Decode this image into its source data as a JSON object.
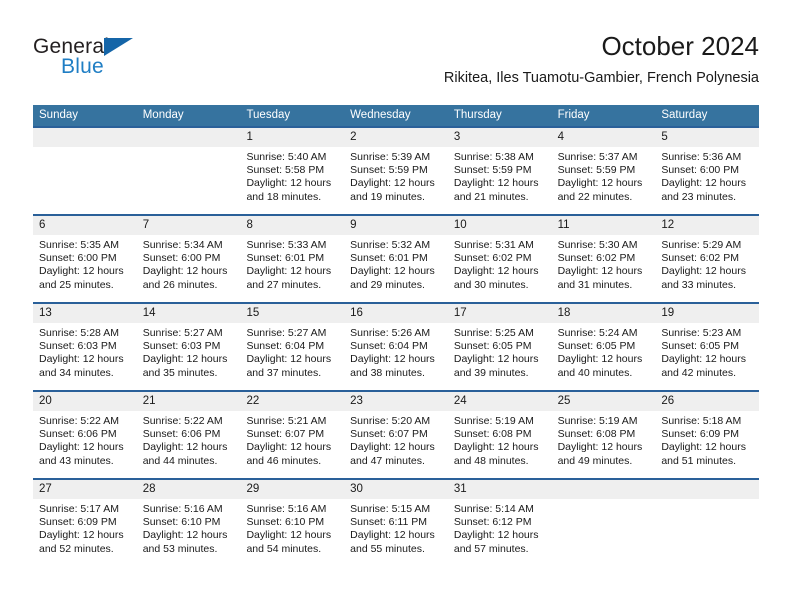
{
  "brand": {
    "name_part1": "General",
    "name_part2": "Blue",
    "logo_icon": "triangle-flag-icon",
    "accent_color": "#1565a8",
    "text_color": "#1f7ec4"
  },
  "header": {
    "title": "October 2024",
    "subtitle": "Rikitea, Iles Tuamotu-Gambier, French Polynesia"
  },
  "calendar": {
    "header_background": "#36739f",
    "row_divider_color": "#2a6099",
    "day_band_background": "#efefef",
    "weekdays": [
      "Sunday",
      "Monday",
      "Tuesday",
      "Wednesday",
      "Thursday",
      "Friday",
      "Saturday"
    ],
    "weeks": [
      [
        {
          "day": "",
          "empty": true,
          "sunrise": "",
          "sunset": "",
          "daylight_line1": "",
          "daylight_line2": ""
        },
        {
          "day": "",
          "empty": true,
          "sunrise": "",
          "sunset": "",
          "daylight_line1": "",
          "daylight_line2": ""
        },
        {
          "day": "1",
          "sunrise": "Sunrise: 5:40 AM",
          "sunset": "Sunset: 5:58 PM",
          "daylight_line1": "Daylight: 12 hours",
          "daylight_line2": "and 18 minutes."
        },
        {
          "day": "2",
          "sunrise": "Sunrise: 5:39 AM",
          "sunset": "Sunset: 5:59 PM",
          "daylight_line1": "Daylight: 12 hours",
          "daylight_line2": "and 19 minutes."
        },
        {
          "day": "3",
          "sunrise": "Sunrise: 5:38 AM",
          "sunset": "Sunset: 5:59 PM",
          "daylight_line1": "Daylight: 12 hours",
          "daylight_line2": "and 21 minutes."
        },
        {
          "day": "4",
          "sunrise": "Sunrise: 5:37 AM",
          "sunset": "Sunset: 5:59 PM",
          "daylight_line1": "Daylight: 12 hours",
          "daylight_line2": "and 22 minutes."
        },
        {
          "day": "5",
          "sunrise": "Sunrise: 5:36 AM",
          "sunset": "Sunset: 6:00 PM",
          "daylight_line1": "Daylight: 12 hours",
          "daylight_line2": "and 23 minutes."
        }
      ],
      [
        {
          "day": "6",
          "sunrise": "Sunrise: 5:35 AM",
          "sunset": "Sunset: 6:00 PM",
          "daylight_line1": "Daylight: 12 hours",
          "daylight_line2": "and 25 minutes."
        },
        {
          "day": "7",
          "sunrise": "Sunrise: 5:34 AM",
          "sunset": "Sunset: 6:00 PM",
          "daylight_line1": "Daylight: 12 hours",
          "daylight_line2": "and 26 minutes."
        },
        {
          "day": "8",
          "sunrise": "Sunrise: 5:33 AM",
          "sunset": "Sunset: 6:01 PM",
          "daylight_line1": "Daylight: 12 hours",
          "daylight_line2": "and 27 minutes."
        },
        {
          "day": "9",
          "sunrise": "Sunrise: 5:32 AM",
          "sunset": "Sunset: 6:01 PM",
          "daylight_line1": "Daylight: 12 hours",
          "daylight_line2": "and 29 minutes."
        },
        {
          "day": "10",
          "sunrise": "Sunrise: 5:31 AM",
          "sunset": "Sunset: 6:02 PM",
          "daylight_line1": "Daylight: 12 hours",
          "daylight_line2": "and 30 minutes."
        },
        {
          "day": "11",
          "sunrise": "Sunrise: 5:30 AM",
          "sunset": "Sunset: 6:02 PM",
          "daylight_line1": "Daylight: 12 hours",
          "daylight_line2": "and 31 minutes."
        },
        {
          "day": "12",
          "sunrise": "Sunrise: 5:29 AM",
          "sunset": "Sunset: 6:02 PM",
          "daylight_line1": "Daylight: 12 hours",
          "daylight_line2": "and 33 minutes."
        }
      ],
      [
        {
          "day": "13",
          "sunrise": "Sunrise: 5:28 AM",
          "sunset": "Sunset: 6:03 PM",
          "daylight_line1": "Daylight: 12 hours",
          "daylight_line2": "and 34 minutes."
        },
        {
          "day": "14",
          "sunrise": "Sunrise: 5:27 AM",
          "sunset": "Sunset: 6:03 PM",
          "daylight_line1": "Daylight: 12 hours",
          "daylight_line2": "and 35 minutes."
        },
        {
          "day": "15",
          "sunrise": "Sunrise: 5:27 AM",
          "sunset": "Sunset: 6:04 PM",
          "daylight_line1": "Daylight: 12 hours",
          "daylight_line2": "and 37 minutes."
        },
        {
          "day": "16",
          "sunrise": "Sunrise: 5:26 AM",
          "sunset": "Sunset: 6:04 PM",
          "daylight_line1": "Daylight: 12 hours",
          "daylight_line2": "and 38 minutes."
        },
        {
          "day": "17",
          "sunrise": "Sunrise: 5:25 AM",
          "sunset": "Sunset: 6:05 PM",
          "daylight_line1": "Daylight: 12 hours",
          "daylight_line2": "and 39 minutes."
        },
        {
          "day": "18",
          "sunrise": "Sunrise: 5:24 AM",
          "sunset": "Sunset: 6:05 PM",
          "daylight_line1": "Daylight: 12 hours",
          "daylight_line2": "and 40 minutes."
        },
        {
          "day": "19",
          "sunrise": "Sunrise: 5:23 AM",
          "sunset": "Sunset: 6:05 PM",
          "daylight_line1": "Daylight: 12 hours",
          "daylight_line2": "and 42 minutes."
        }
      ],
      [
        {
          "day": "20",
          "sunrise": "Sunrise: 5:22 AM",
          "sunset": "Sunset: 6:06 PM",
          "daylight_line1": "Daylight: 12 hours",
          "daylight_line2": "and 43 minutes."
        },
        {
          "day": "21",
          "sunrise": "Sunrise: 5:22 AM",
          "sunset": "Sunset: 6:06 PM",
          "daylight_line1": "Daylight: 12 hours",
          "daylight_line2": "and 44 minutes."
        },
        {
          "day": "22",
          "sunrise": "Sunrise: 5:21 AM",
          "sunset": "Sunset: 6:07 PM",
          "daylight_line1": "Daylight: 12 hours",
          "daylight_line2": "and 46 minutes."
        },
        {
          "day": "23",
          "sunrise": "Sunrise: 5:20 AM",
          "sunset": "Sunset: 6:07 PM",
          "daylight_line1": "Daylight: 12 hours",
          "daylight_line2": "and 47 minutes."
        },
        {
          "day": "24",
          "sunrise": "Sunrise: 5:19 AM",
          "sunset": "Sunset: 6:08 PM",
          "daylight_line1": "Daylight: 12 hours",
          "daylight_line2": "and 48 minutes."
        },
        {
          "day": "25",
          "sunrise": "Sunrise: 5:19 AM",
          "sunset": "Sunset: 6:08 PM",
          "daylight_line1": "Daylight: 12 hours",
          "daylight_line2": "and 49 minutes."
        },
        {
          "day": "26",
          "sunrise": "Sunrise: 5:18 AM",
          "sunset": "Sunset: 6:09 PM",
          "daylight_line1": "Daylight: 12 hours",
          "daylight_line2": "and 51 minutes."
        }
      ],
      [
        {
          "day": "27",
          "sunrise": "Sunrise: 5:17 AM",
          "sunset": "Sunset: 6:09 PM",
          "daylight_line1": "Daylight: 12 hours",
          "daylight_line2": "and 52 minutes."
        },
        {
          "day": "28",
          "sunrise": "Sunrise: 5:16 AM",
          "sunset": "Sunset: 6:10 PM",
          "daylight_line1": "Daylight: 12 hours",
          "daylight_line2": "and 53 minutes."
        },
        {
          "day": "29",
          "sunrise": "Sunrise: 5:16 AM",
          "sunset": "Sunset: 6:10 PM",
          "daylight_line1": "Daylight: 12 hours",
          "daylight_line2": "and 54 minutes."
        },
        {
          "day": "30",
          "sunrise": "Sunrise: 5:15 AM",
          "sunset": "Sunset: 6:11 PM",
          "daylight_line1": "Daylight: 12 hours",
          "daylight_line2": "and 55 minutes."
        },
        {
          "day": "31",
          "sunrise": "Sunrise: 5:14 AM",
          "sunset": "Sunset: 6:12 PM",
          "daylight_line1": "Daylight: 12 hours",
          "daylight_line2": "and 57 minutes."
        },
        {
          "day": "",
          "empty": true,
          "sunrise": "",
          "sunset": "",
          "daylight_line1": "",
          "daylight_line2": ""
        },
        {
          "day": "",
          "empty": true,
          "sunrise": "",
          "sunset": "",
          "daylight_line1": "",
          "daylight_line2": ""
        }
      ]
    ]
  }
}
